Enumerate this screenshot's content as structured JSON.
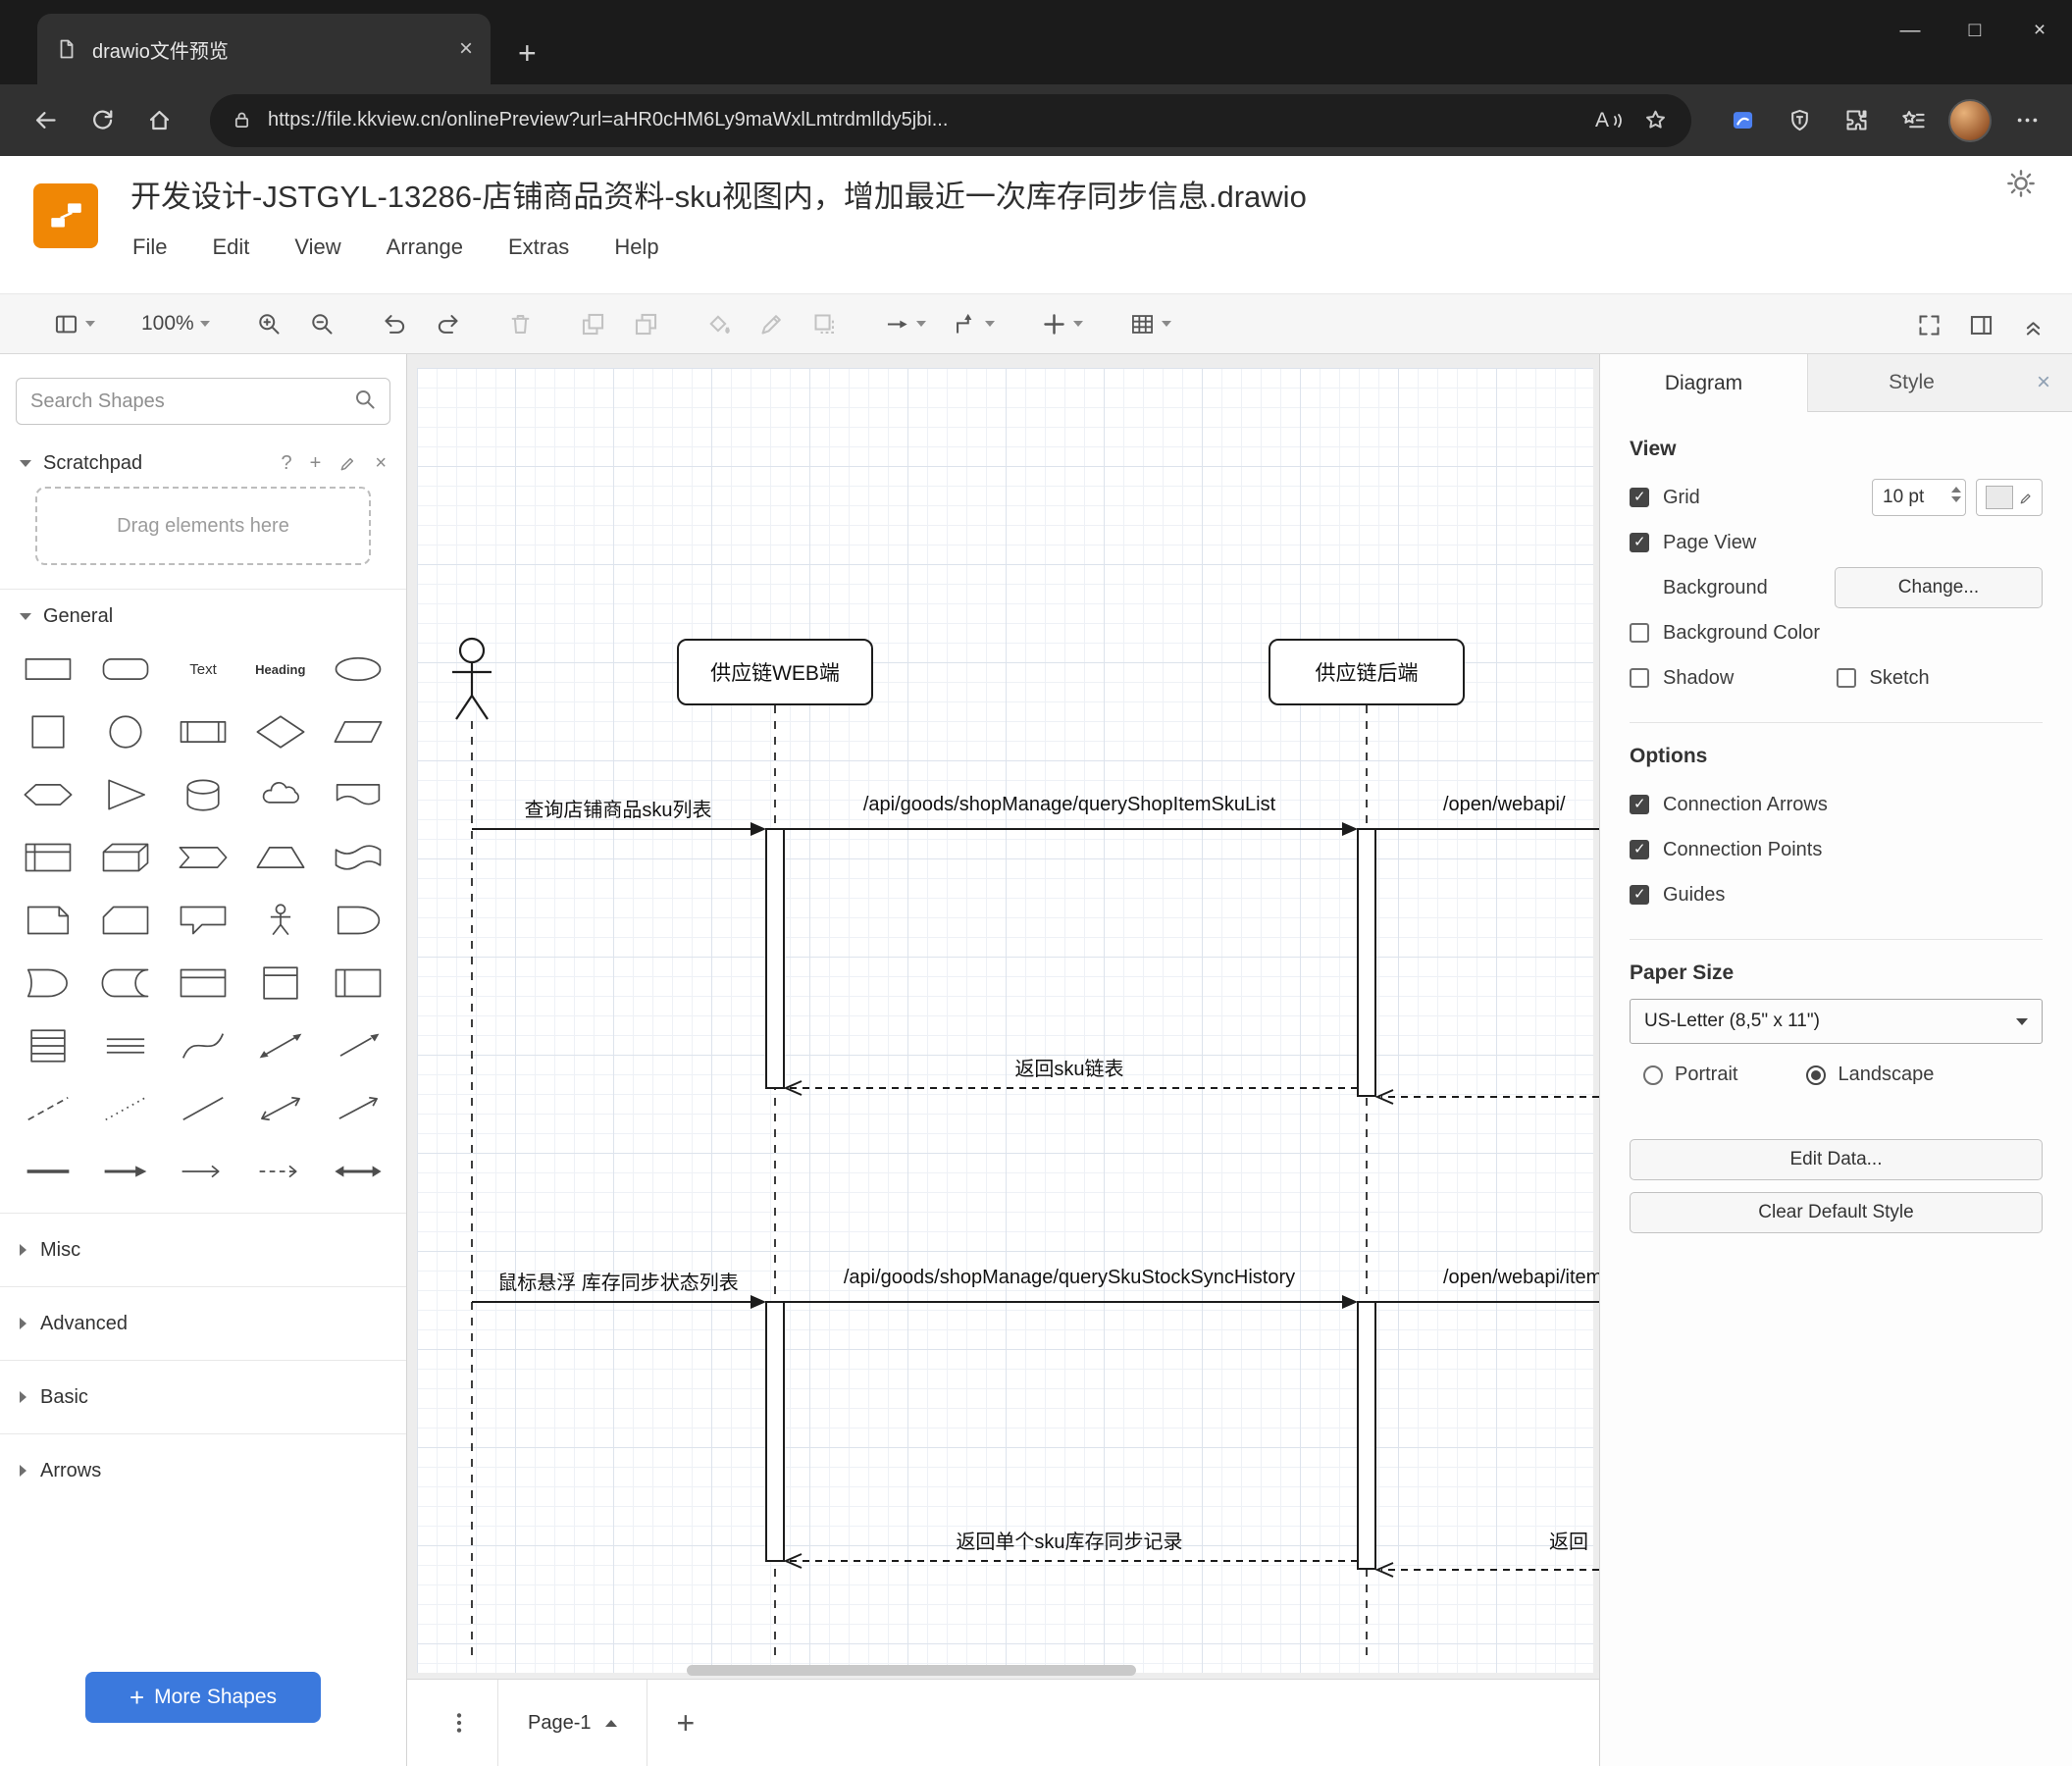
{
  "browser": {
    "tab_title": "drawio文件预览",
    "tab_close": "×",
    "new_tab": "+",
    "url": "https://file.kkview.cn/onlinePreview?url=aHR0cHM6Ly9maWxlLmtrdmlldy5jbi...",
    "read_aloud_label": "A",
    "window_controls": {
      "minimize": "—",
      "maximize": "□",
      "close": "×"
    }
  },
  "app": {
    "title": "开发设计-JSTGYL-13286-店铺商品资料-sku视图内，增加最近一次库存同步信息.drawio",
    "menus": [
      "File",
      "Edit",
      "View",
      "Arrange",
      "Extras",
      "Help"
    ],
    "zoom_level": "100%"
  },
  "sidebar": {
    "search_placeholder": "Search Shapes",
    "scratchpad": {
      "title": "Scratchpad",
      "help": "?",
      "add": "+",
      "close": "×",
      "hint": "Drag elements here"
    },
    "sections": [
      {
        "label": "General",
        "expanded": true
      },
      {
        "label": "Misc",
        "expanded": false
      },
      {
        "label": "Advanced",
        "expanded": false
      },
      {
        "label": "Basic",
        "expanded": false
      },
      {
        "label": "Arrows",
        "expanded": false
      }
    ],
    "shapes": [
      {
        "name": "rectangle"
      },
      {
        "name": "rounded-rectangle"
      },
      {
        "name": "text",
        "label": "Text"
      },
      {
        "name": "heading",
        "label": "Heading"
      },
      {
        "name": "ellipse"
      },
      {
        "name": "square"
      },
      {
        "name": "circle"
      },
      {
        "name": "process"
      },
      {
        "name": "diamond"
      },
      {
        "name": "parallelogram"
      },
      {
        "name": "hexagon"
      },
      {
        "name": "triangle"
      },
      {
        "name": "cylinder"
      },
      {
        "name": "cloud"
      },
      {
        "name": "document"
      },
      {
        "name": "internal-storage"
      },
      {
        "name": "cube"
      },
      {
        "name": "step"
      },
      {
        "name": "trapezoid"
      },
      {
        "name": "tape"
      },
      {
        "name": "note"
      },
      {
        "name": "card"
      },
      {
        "name": "callout"
      },
      {
        "name": "actor"
      },
      {
        "name": "or"
      },
      {
        "name": "and"
      },
      {
        "name": "data-storage"
      },
      {
        "name": "container"
      },
      {
        "name": "vertical-container"
      },
      {
        "name": "horizontal-container"
      },
      {
        "name": "list"
      },
      {
        "name": "list-item"
      },
      {
        "name": "curve"
      },
      {
        "name": "bidirectional-arrow"
      },
      {
        "name": "arrow"
      },
      {
        "name": "dashed-line"
      },
      {
        "name": "dotted-line"
      },
      {
        "name": "line"
      },
      {
        "name": "bidirectional-connector"
      },
      {
        "name": "directional-connector"
      },
      {
        "name": "horizontal-line"
      },
      {
        "name": "horizontal-arrow"
      },
      {
        "name": "thin-arrow"
      },
      {
        "name": "dashed-horizontal-arrow"
      },
      {
        "name": "double-arrow"
      }
    ],
    "more_shapes": {
      "plus": "+",
      "label": "More Shapes"
    }
  },
  "canvas": {
    "page_tab": "Page-1",
    "add_page": "+",
    "diagram": {
      "type": "sequence",
      "participants": [
        {
          "name": "actor",
          "label": ""
        },
        {
          "name": "web",
          "label": "供应链WEB端"
        },
        {
          "name": "backend",
          "label": "供应链后端"
        }
      ],
      "messages": [
        {
          "from": "actor",
          "to": "供应链WEB端",
          "style": "solid",
          "label": "查询店铺商品sku列表"
        },
        {
          "from": "供应链WEB端",
          "to": "供应链后端",
          "style": "solid",
          "label": "/api/goods/shopManage/queryShopItemSkuList"
        },
        {
          "from": "供应链后端",
          "to": "offscreen-right",
          "style": "solid",
          "label": "/open/webapi/"
        },
        {
          "from": "供应链后端",
          "to": "供应链WEB端",
          "style": "dashed-return",
          "label": "返回sku链表"
        },
        {
          "from": "actor",
          "to": "供应链WEB端",
          "style": "solid",
          "label": "鼠标悬浮 库存同步状态列表"
        },
        {
          "from": "供应链WEB端",
          "to": "供应链后端",
          "style": "solid",
          "label": "/api/goods/shopManage/querySkuStockSyncHistory"
        },
        {
          "from": "供应链后端",
          "to": "offscreen-right",
          "style": "solid",
          "label": "/open/webapi/item"
        },
        {
          "from": "供应链后端",
          "to": "供应链WEB端",
          "style": "dashed-return",
          "label": "返回单个sku库存同步记录"
        },
        {
          "from": "offscreen-right",
          "to": "供应链后端",
          "style": "dashed-return",
          "label": "返回"
        }
      ]
    }
  },
  "format_panel": {
    "tabs": [
      {
        "label": "Diagram",
        "active": true
      },
      {
        "label": "Style",
        "active": false
      }
    ],
    "close": "×",
    "view": {
      "heading": "View",
      "grid": {
        "label": "Grid",
        "checked": true,
        "value": "10 pt"
      },
      "page_view": {
        "label": "Page View",
        "checked": true
      },
      "background": {
        "label": "Background",
        "button": "Change..."
      },
      "background_color": {
        "label": "Background Color",
        "checked": false
      },
      "shadow": {
        "label": "Shadow",
        "checked": false
      },
      "sketch": {
        "label": "Sketch",
        "checked": false
      }
    },
    "options": {
      "heading": "Options",
      "items": [
        {
          "label": "Connection Arrows",
          "checked": true
        },
        {
          "label": "Connection Points",
          "checked": true
        },
        {
          "label": "Guides",
          "checked": true
        }
      ]
    },
    "paper": {
      "heading": "Paper Size",
      "selected_size": "US-Letter (8,5\" x 11\")",
      "portrait": {
        "label": "Portrait",
        "selected": false
      },
      "landscape": {
        "label": "Landscape",
        "selected": true
      }
    },
    "actions": {
      "edit_data": "Edit Data...",
      "clear_default_style": "Clear Default Style"
    }
  },
  "colors": {
    "accent_blue": "#3b79dd",
    "logo_orange": "#f08705"
  }
}
